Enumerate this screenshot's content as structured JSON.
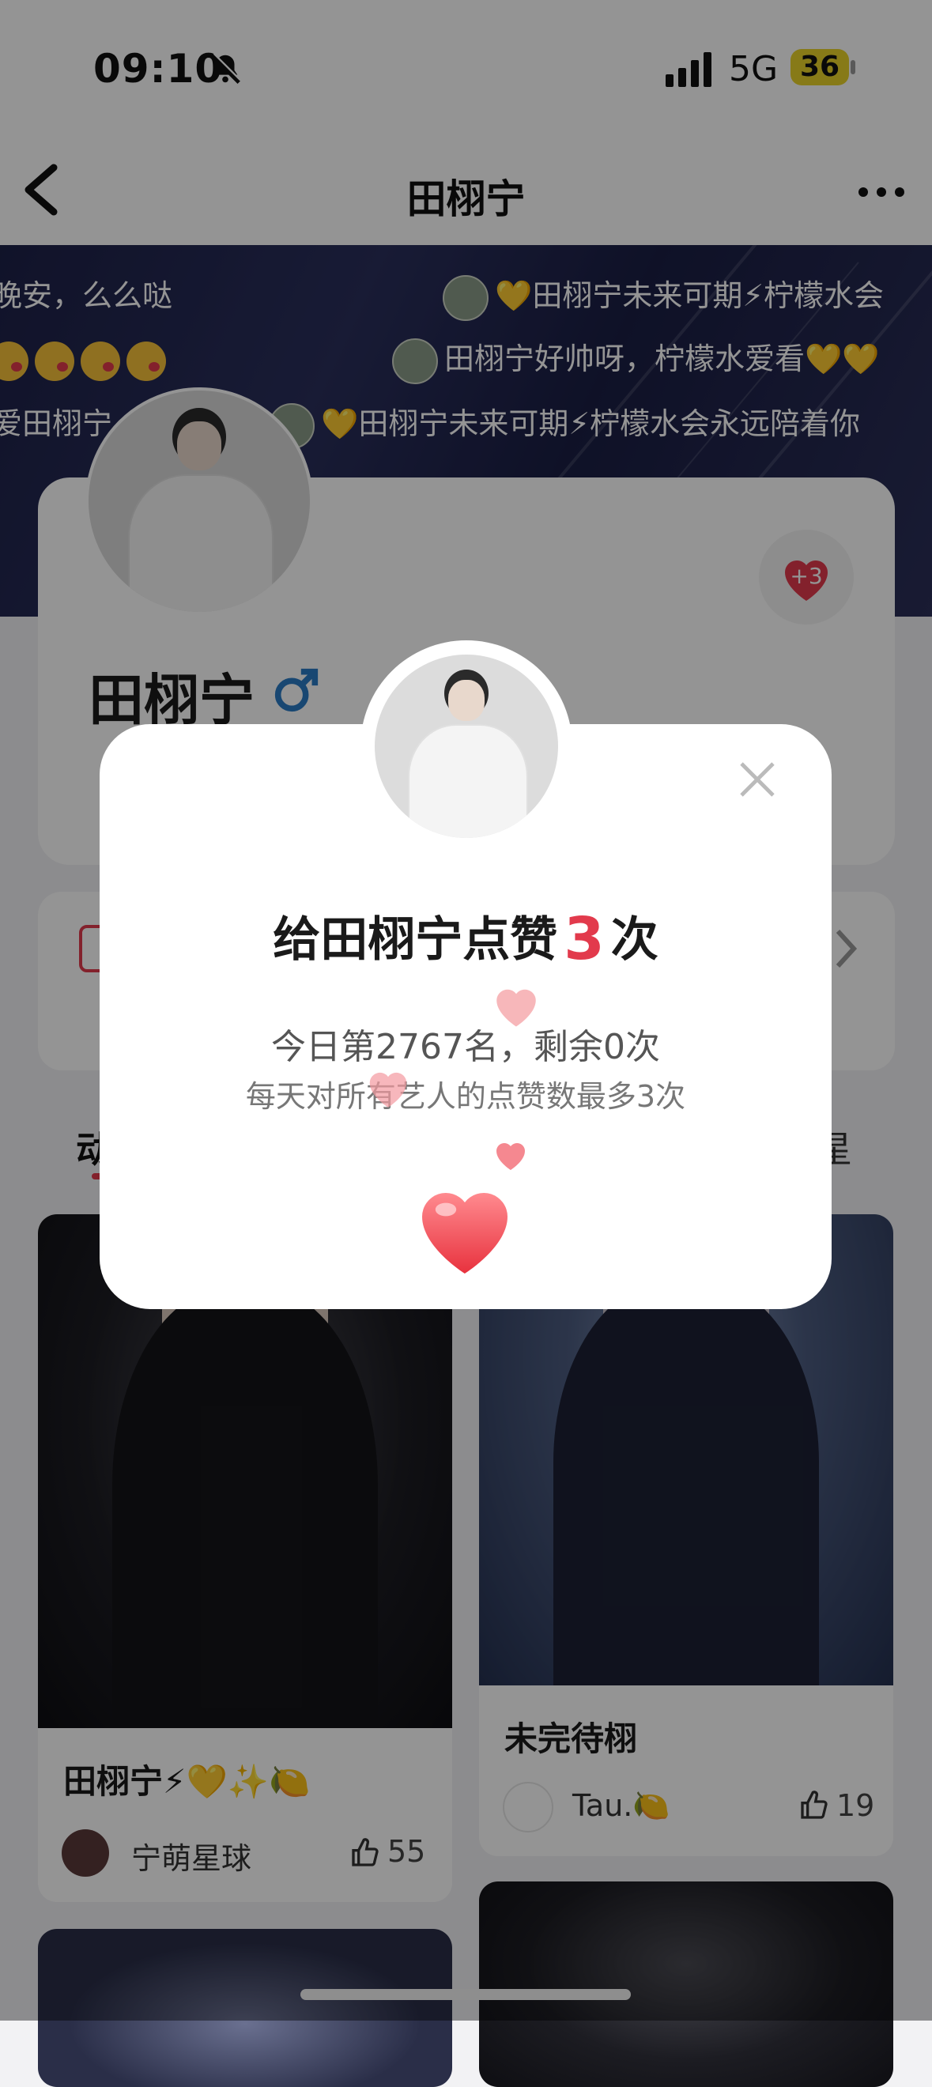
{
  "status_bar": {
    "time": "09:10",
    "network": "5G",
    "battery": "36"
  },
  "nav": {
    "title": "田栩宁"
  },
  "danmaku": [
    {
      "text": "晚安，么么哒"
    },
    {
      "text": "💛田栩宁未来可期⚡柠檬水会"
    },
    {
      "text": "田栩宁好帅呀，柠檬水爱看💛💛"
    },
    {
      "text": "爱田栩宁"
    },
    {
      "text": "💛田栩宁未来可期⚡柠檬水会永远陪着你"
    }
  ],
  "profile": {
    "name": "田栩宁",
    "gender_symbol": "♂",
    "boost": "+3"
  },
  "tabs": {
    "left": "动",
    "right": "星"
  },
  "posts": [
    {
      "title": "田栩宁⚡💛✨🍋",
      "author": "宁萌星球",
      "likes": "55"
    },
    {
      "title": "未完待栩",
      "author": "Tau.🍋",
      "likes": "19"
    }
  ],
  "modal": {
    "title_prefix": "给田栩宁点赞",
    "count": "3",
    "title_suffix": "次",
    "rank": "今日第2767名，剩余0次",
    "note": "每天对所有艺人的点赞数最多3次"
  },
  "colors": {
    "accent": "#e23a4c",
    "banner": "#1d2148"
  }
}
